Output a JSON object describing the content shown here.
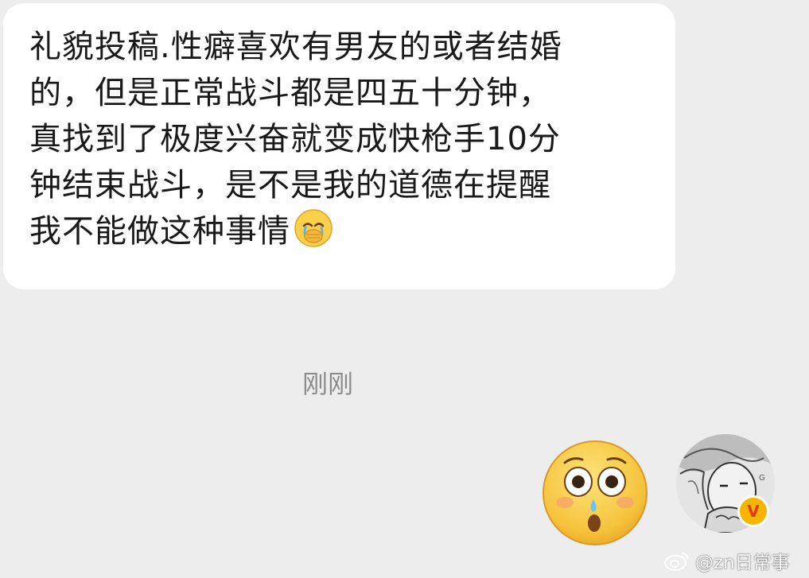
{
  "message": {
    "lines": [
      "礼貌投稿.性癖喜欢有男友的或者结婚",
      "的，但是正常战斗都是四五十分钟，",
      "真找到了极度兴奋就变成快枪手10分",
      "钟结束战斗，是不是我的道德在提醒",
      "我不能做这种事情"
    ],
    "trailing_emoji": "cover-mouth-crying-emoji"
  },
  "timestamp": "刚刚",
  "sticker": {
    "icon": "shocked-face-sticker"
  },
  "avatar": {
    "icon": "manga-portrait-avatar",
    "badge_label": "V",
    "badge_color": "#f7b500"
  },
  "watermark": {
    "icon": "weibo-logo-icon",
    "text": "@zn日常事"
  }
}
